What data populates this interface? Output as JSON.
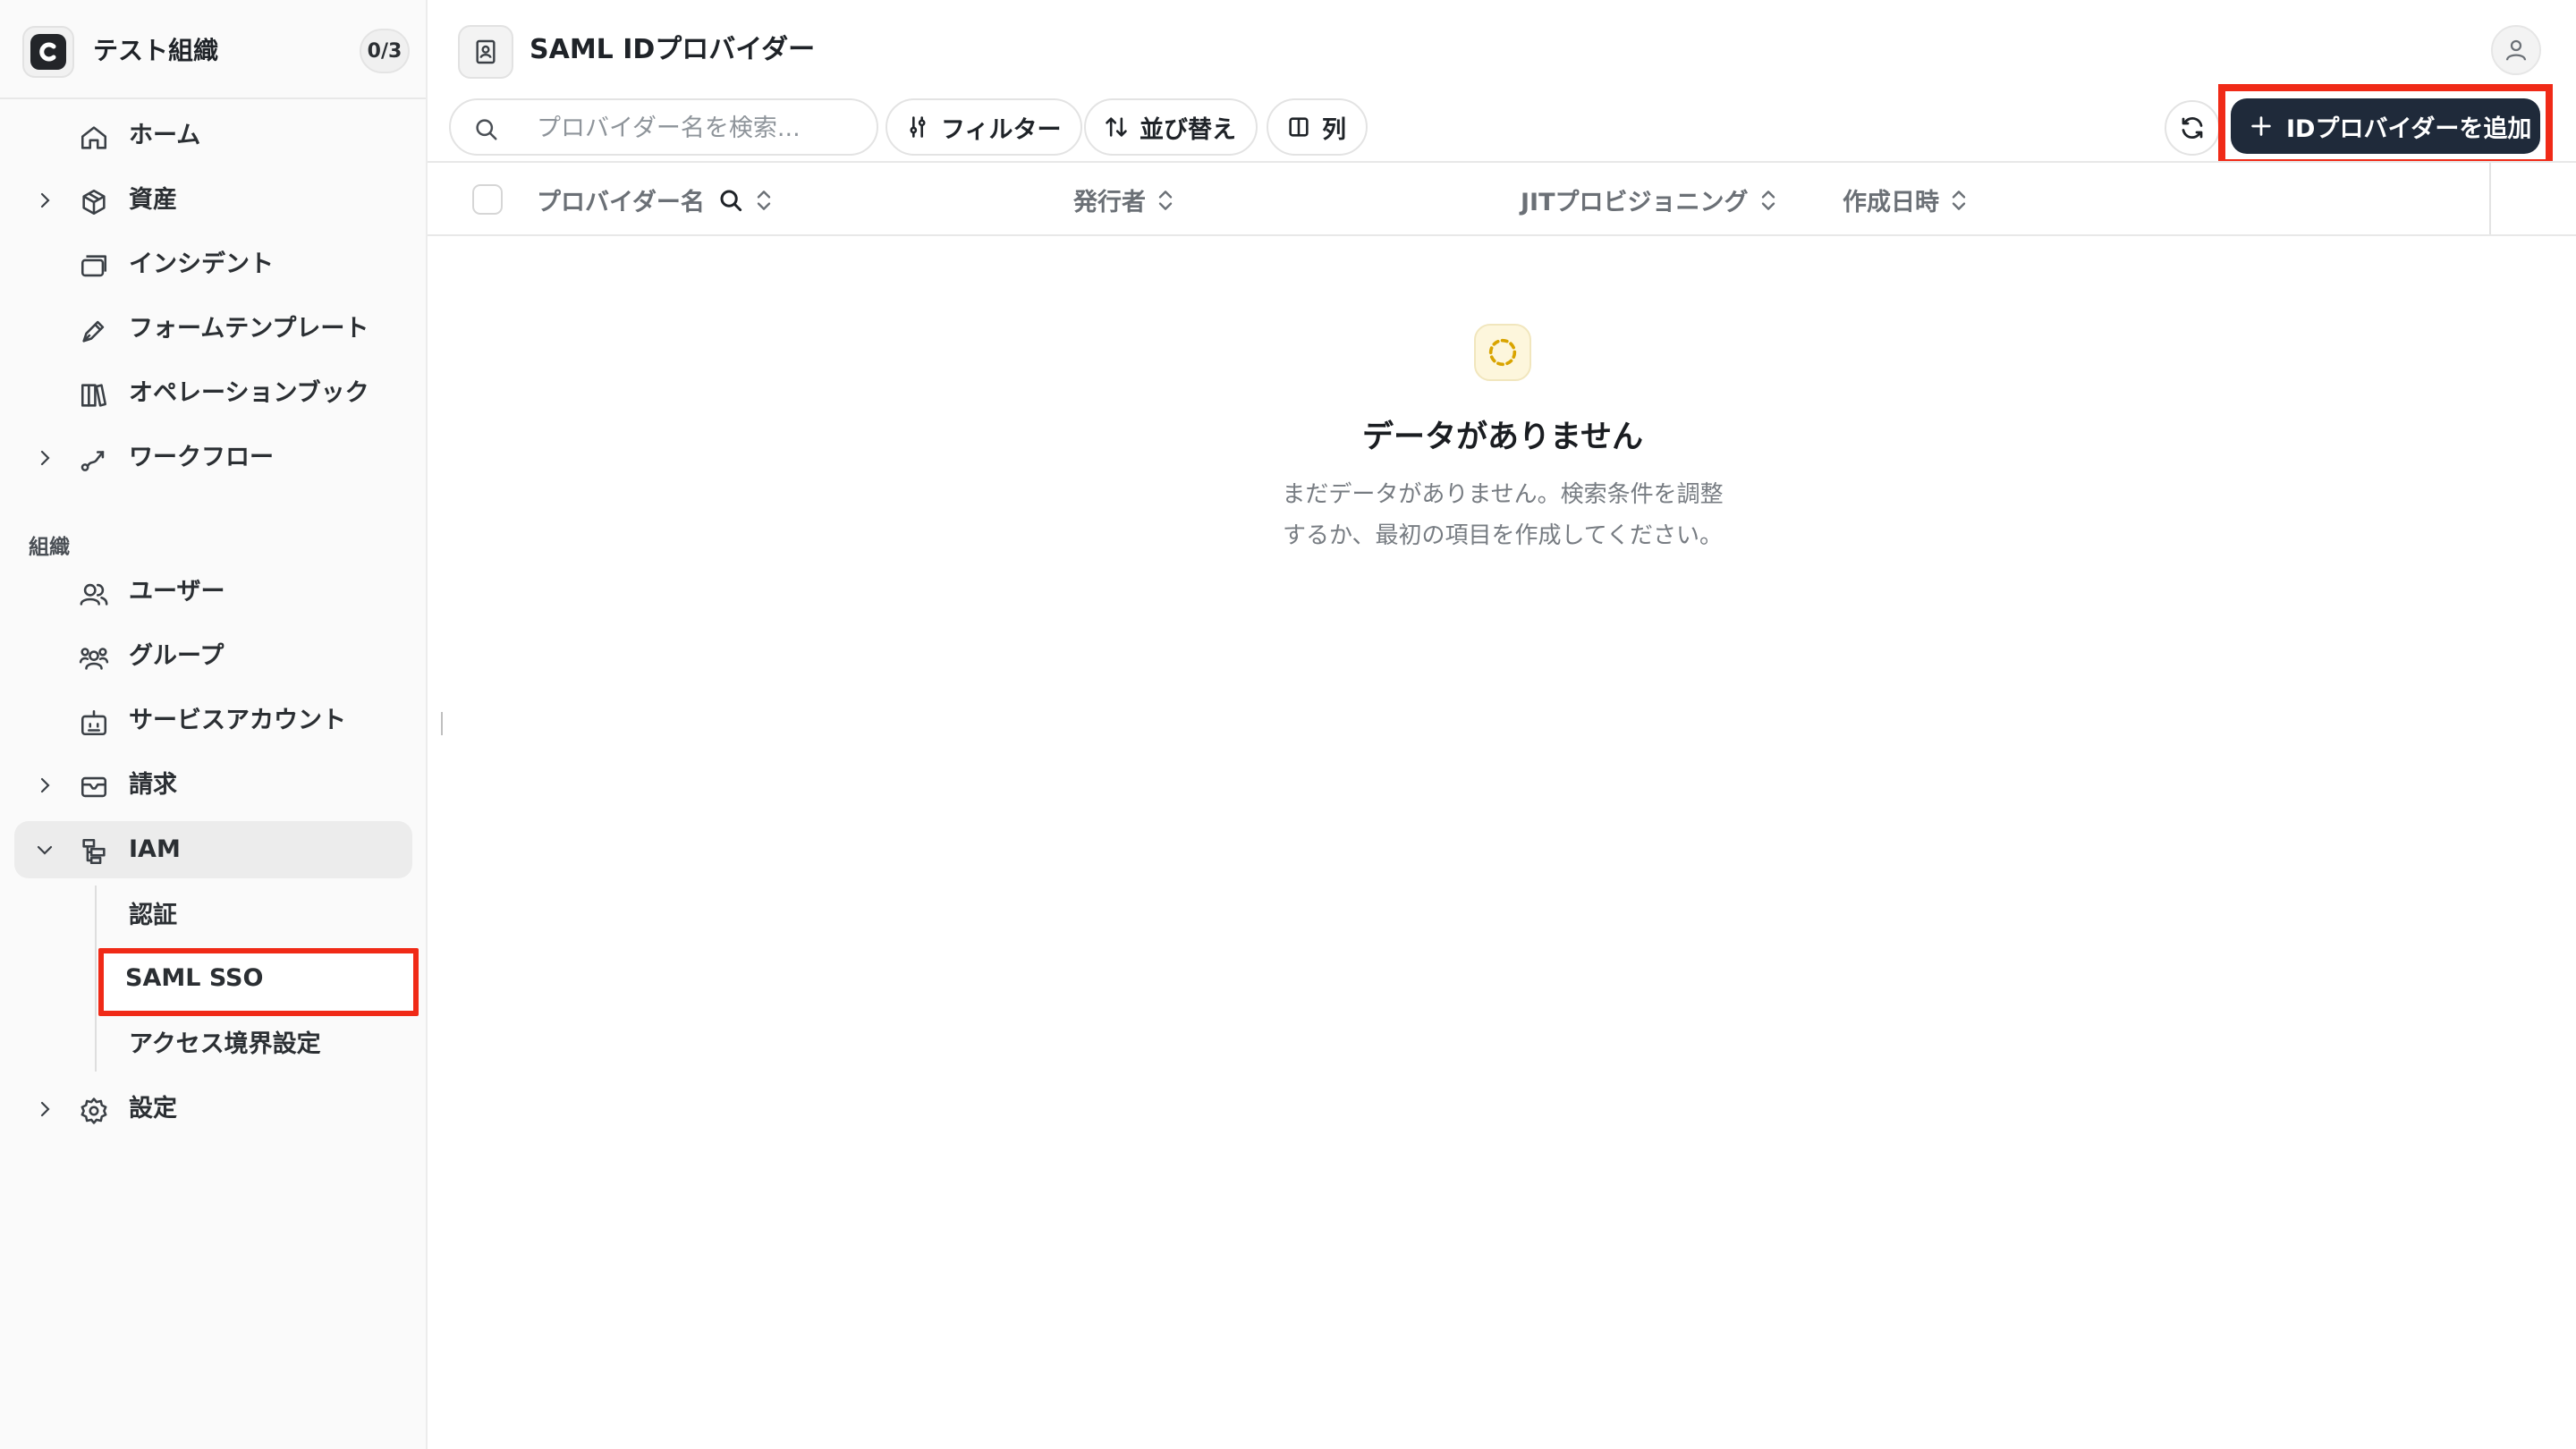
{
  "org": {
    "name": "テスト組織",
    "count": "0/3"
  },
  "sidebar": {
    "items": [
      {
        "label": "ホーム",
        "icon": "home-icon"
      },
      {
        "label": "資産",
        "icon": "box-icon"
      },
      {
        "label": "インシデント",
        "icon": "cards-icon"
      },
      {
        "label": "フォームテンプレート",
        "icon": "pen-icon"
      },
      {
        "label": "オペレーションブック",
        "icon": "books-icon"
      },
      {
        "label": "ワークフロー",
        "icon": "workflow-icon"
      }
    ],
    "section_label": "組織",
    "org_items": [
      {
        "label": "ユーザー",
        "icon": "users-icon"
      },
      {
        "label": "グループ",
        "icon": "group-icon"
      },
      {
        "label": "サービスアカウント",
        "icon": "bot-icon"
      },
      {
        "label": "請求",
        "icon": "wallet-icon"
      },
      {
        "label": "IAM",
        "icon": "iam-icon"
      }
    ],
    "iam_sub": [
      "認証",
      "SAML SSO",
      "アクセス境界設定"
    ],
    "settings": {
      "label": "設定",
      "icon": "gear-icon"
    }
  },
  "header": {
    "title": "SAML IDプロバイダー"
  },
  "toolbar": {
    "search_placeholder": "プロバイダー名を検索...",
    "filter": "フィルター",
    "sort": "並び替え",
    "columns": "列",
    "add": "IDプロバイダーを追加"
  },
  "table": {
    "columns": [
      "プロバイダー名",
      "発行者",
      "JITプロビジョニング",
      "作成日時"
    ]
  },
  "empty": {
    "title": "データがありません",
    "line1": "まだデータがありません。検索条件を調整",
    "line2": "するか、最初の項目を作成してください。"
  },
  "colors": {
    "highlight": "#f02a17",
    "primary": "#1f2a3a",
    "active_bg": "#ececec",
    "empty_accent": "#d9a400"
  }
}
